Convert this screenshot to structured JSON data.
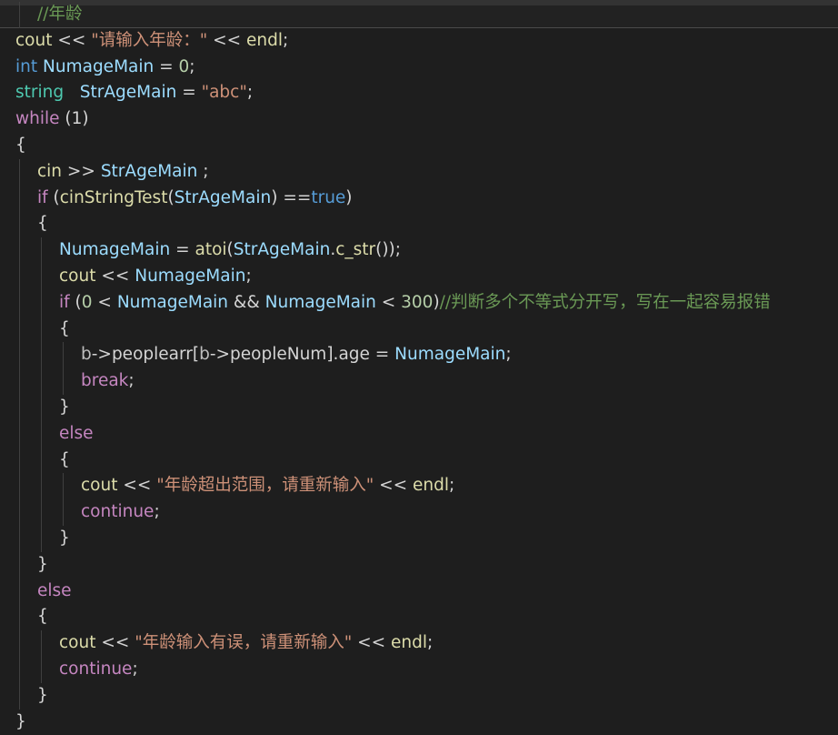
{
  "editor": {
    "language": "C++",
    "theme": "dark",
    "background": "#1e1e1e",
    "colors": {
      "keyword": "#569cd6",
      "control": "#c586c0",
      "type": "#4ec9b0",
      "variable": "#9cdcfe",
      "function": "#dcdcaa",
      "string": "#ce9178",
      "number": "#b5cea8",
      "comment": "#6a9955",
      "plain": "#d4d4d4"
    },
    "lines": [
      {
        "indent": 1,
        "tokens": [
          {
            "t": "//年龄",
            "c": "cmt"
          }
        ]
      },
      {
        "indent": 0,
        "tokens": [
          {
            "t": "cout",
            "c": "fn"
          },
          {
            "t": " << ",
            "c": "pl"
          },
          {
            "t": "\"请输入年龄：\"",
            "c": "str"
          },
          {
            "t": " << ",
            "c": "pl"
          },
          {
            "t": "endl",
            "c": "fn"
          },
          {
            "t": ";",
            "c": "pl"
          }
        ]
      },
      {
        "indent": 0,
        "tokens": [
          {
            "t": "int",
            "c": "kw"
          },
          {
            "t": " ",
            "c": "pl"
          },
          {
            "t": "NumageMain",
            "c": "var"
          },
          {
            "t": " = ",
            "c": "pl"
          },
          {
            "t": "0",
            "c": "num"
          },
          {
            "t": ";",
            "c": "pl"
          }
        ]
      },
      {
        "indent": 0,
        "tokens": [
          {
            "t": "string",
            "c": "ty"
          },
          {
            "t": "   ",
            "c": "pl"
          },
          {
            "t": "StrAgeMain",
            "c": "var"
          },
          {
            "t": " = ",
            "c": "pl"
          },
          {
            "t": "\"abc\"",
            "c": "str"
          },
          {
            "t": ";",
            "c": "pl"
          }
        ]
      },
      {
        "indent": 0,
        "tokens": [
          {
            "t": "while",
            "c": "ctl"
          },
          {
            "t": " (1)",
            "c": "pl"
          }
        ]
      },
      {
        "indent": 0,
        "tokens": [
          {
            "t": "{",
            "c": "pl"
          }
        ]
      },
      {
        "indent": 1,
        "tokens": [
          {
            "t": "cin",
            "c": "fn"
          },
          {
            "t": " >> ",
            "c": "pl"
          },
          {
            "t": "StrAgeMain",
            "c": "var"
          },
          {
            "t": " ;",
            "c": "pl"
          }
        ]
      },
      {
        "indent": 1,
        "tokens": [
          {
            "t": "if",
            "c": "ctl"
          },
          {
            "t": " (",
            "c": "pl"
          },
          {
            "t": "cinStringTest",
            "c": "fn"
          },
          {
            "t": "(",
            "c": "pl"
          },
          {
            "t": "StrAgeMain",
            "c": "var"
          },
          {
            "t": ") ==",
            "c": "pl"
          },
          {
            "t": "true",
            "c": "kw"
          },
          {
            "t": ")",
            "c": "pl"
          }
        ]
      },
      {
        "indent": 1,
        "tokens": [
          {
            "t": "{",
            "c": "pl"
          }
        ]
      },
      {
        "indent": 2,
        "tokens": [
          {
            "t": "NumageMain",
            "c": "var"
          },
          {
            "t": " = ",
            "c": "pl"
          },
          {
            "t": "atoi",
            "c": "fn"
          },
          {
            "t": "(",
            "c": "pl"
          },
          {
            "t": "StrAgeMain",
            "c": "var"
          },
          {
            "t": ".",
            "c": "pl"
          },
          {
            "t": "c_str",
            "c": "fn"
          },
          {
            "t": "());",
            "c": "pl"
          }
        ]
      },
      {
        "indent": 2,
        "tokens": [
          {
            "t": "cout",
            "c": "fn"
          },
          {
            "t": " << ",
            "c": "pl"
          },
          {
            "t": "NumageMain",
            "c": "var"
          },
          {
            "t": ";",
            "c": "pl"
          }
        ]
      },
      {
        "indent": 2,
        "tokens": [
          {
            "t": "if",
            "c": "ctl"
          },
          {
            "t": " (",
            "c": "pl"
          },
          {
            "t": "0",
            "c": "num"
          },
          {
            "t": " < ",
            "c": "pl"
          },
          {
            "t": "NumageMain",
            "c": "var"
          },
          {
            "t": " && ",
            "c": "pl"
          },
          {
            "t": "NumageMain",
            "c": "var"
          },
          {
            "t": " < ",
            "c": "pl"
          },
          {
            "t": "300",
            "c": "num"
          },
          {
            "t": ")",
            "c": "pl"
          },
          {
            "t": "//判断多个不等式分开写，写在一起容易报错",
            "c": "cmt"
          }
        ]
      },
      {
        "indent": 2,
        "tokens": [
          {
            "t": "{",
            "c": "pl"
          }
        ]
      },
      {
        "indent": 3,
        "tokens": [
          {
            "t": "b",
            "c": "mac"
          },
          {
            "t": "->",
            "c": "pl"
          },
          {
            "t": "peoplearr",
            "c": "pl"
          },
          {
            "t": "[",
            "c": "pl"
          },
          {
            "t": "b",
            "c": "mac"
          },
          {
            "t": "->",
            "c": "pl"
          },
          {
            "t": "peopleNum",
            "c": "pl"
          },
          {
            "t": "].",
            "c": "pl"
          },
          {
            "t": "age",
            "c": "pl"
          },
          {
            "t": " = ",
            "c": "pl"
          },
          {
            "t": "NumageMain",
            "c": "var"
          },
          {
            "t": ";",
            "c": "pl"
          }
        ]
      },
      {
        "indent": 3,
        "tokens": [
          {
            "t": "break",
            "c": "ctl"
          },
          {
            "t": ";",
            "c": "pl"
          }
        ]
      },
      {
        "indent": 2,
        "tokens": [
          {
            "t": "}",
            "c": "pl"
          }
        ]
      },
      {
        "indent": 2,
        "tokens": [
          {
            "t": "else",
            "c": "ctl"
          }
        ]
      },
      {
        "indent": 2,
        "tokens": [
          {
            "t": "{",
            "c": "pl"
          }
        ]
      },
      {
        "indent": 3,
        "tokens": [
          {
            "t": "cout",
            "c": "fn"
          },
          {
            "t": " << ",
            "c": "pl"
          },
          {
            "t": "\"年龄超出范围，请重新输入\"",
            "c": "str"
          },
          {
            "t": " << ",
            "c": "pl"
          },
          {
            "t": "endl",
            "c": "fn"
          },
          {
            "t": ";",
            "c": "pl"
          }
        ]
      },
      {
        "indent": 3,
        "tokens": [
          {
            "t": "continue",
            "c": "ctl"
          },
          {
            "t": ";",
            "c": "pl"
          }
        ]
      },
      {
        "indent": 2,
        "tokens": [
          {
            "t": "}",
            "c": "pl"
          }
        ]
      },
      {
        "indent": 1,
        "tokens": [
          {
            "t": "}",
            "c": "pl"
          }
        ]
      },
      {
        "indent": 1,
        "tokens": [
          {
            "t": "else",
            "c": "ctl"
          }
        ]
      },
      {
        "indent": 1,
        "tokens": [
          {
            "t": "{",
            "c": "pl"
          }
        ]
      },
      {
        "indent": 2,
        "tokens": [
          {
            "t": "cout",
            "c": "fn"
          },
          {
            "t": " << ",
            "c": "pl"
          },
          {
            "t": "\"年龄输入有误，请重新输入\"",
            "c": "str"
          },
          {
            "t": " << ",
            "c": "pl"
          },
          {
            "t": "endl",
            "c": "fn"
          },
          {
            "t": ";",
            "c": "pl"
          }
        ]
      },
      {
        "indent": 2,
        "tokens": [
          {
            "t": "continue",
            "c": "ctl"
          },
          {
            "t": ";",
            "c": "pl"
          }
        ]
      },
      {
        "indent": 1,
        "tokens": [
          {
            "t": "}",
            "c": "pl"
          }
        ]
      },
      {
        "indent": 0,
        "tokens": [
          {
            "t": "}",
            "c": "pl"
          }
        ]
      }
    ]
  }
}
